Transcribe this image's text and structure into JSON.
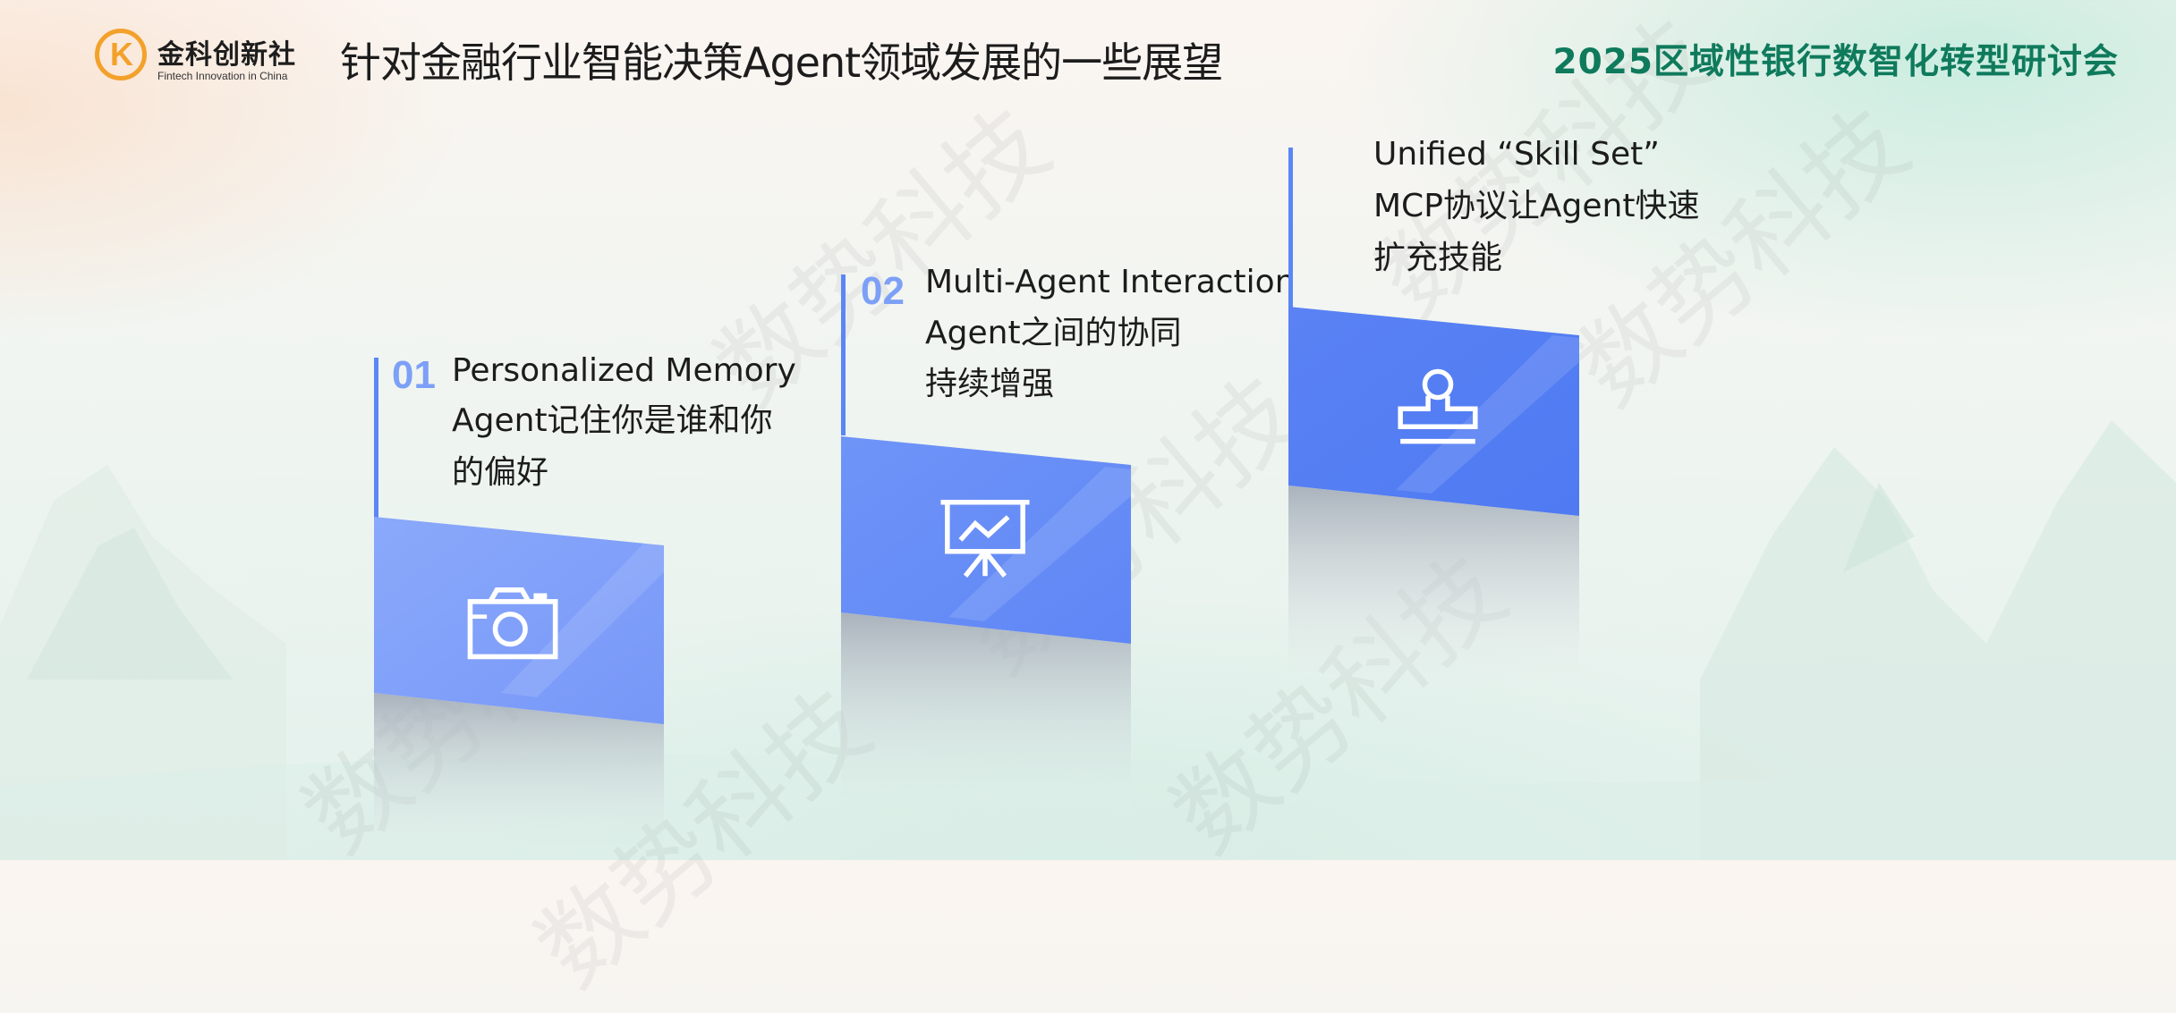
{
  "header": {
    "logo_name": "金科创新社",
    "logo_tagline": "Fintech Innovation in China",
    "logo_mark": "K",
    "title": "针对金融行业智能决策Agent领域发展的一些展望",
    "event": "2025区域性银行数智化转型研讨会"
  },
  "watermark": "数势科技",
  "steps": [
    {
      "number": "01",
      "title": "Personalized Memory",
      "line2": "Agent记住你是谁和你",
      "line3": "的偏好",
      "icon": "camera-icon"
    },
    {
      "number": "02",
      "title": "Multi-Agent Interaction",
      "line2": "Agent之间的协同",
      "line3": "持续增强",
      "icon": "presentation-chart-icon"
    },
    {
      "number": "",
      "title": "Unified “Skill Set”",
      "line2": "MCP协议让Agent快速",
      "line3": "扩充技能",
      "icon": "stamp-icon"
    }
  ],
  "colors": {
    "accent_blue": "#5b86f5",
    "light_blue": "#8aa9fb",
    "brand_green": "#0f7a5c",
    "logo_orange": "#f3a12b"
  }
}
